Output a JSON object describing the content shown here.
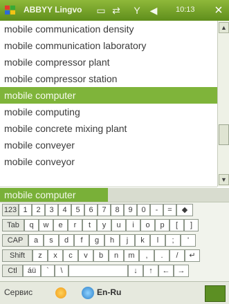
{
  "titlebar": {
    "title": "ABBYY Lingvo",
    "time": "10:13",
    "close": "×",
    "icons": [
      "windows-flag-icon",
      "window-icon",
      "connectivity-icon",
      "signal-icon",
      "volume-icon"
    ]
  },
  "list": {
    "items": [
      "mobile communication density",
      "mobile communication laboratory",
      "mobile compressor plant",
      "mobile compressor station",
      "mobile computer",
      "mobile computing",
      "mobile concrete mixing plant",
      "mobile conveyer",
      "mobile conveyor"
    ],
    "selected_index": 4
  },
  "input": {
    "value": "mobile computer"
  },
  "keyboard": {
    "row1": [
      "123",
      "1",
      "2",
      "3",
      "4",
      "5",
      "6",
      "7",
      "8",
      "9",
      "0",
      "-",
      "=",
      "◆"
    ],
    "row2": [
      "Tab",
      "q",
      "w",
      "e",
      "r",
      "t",
      "y",
      "u",
      "i",
      "o",
      "p",
      "[",
      "]"
    ],
    "row3": [
      "CAP",
      "a",
      "s",
      "d",
      "f",
      "g",
      "h",
      "j",
      "k",
      "l",
      ";",
      "'"
    ],
    "row4": [
      "Shift",
      "z",
      "x",
      "c",
      "v",
      "b",
      "n",
      "m",
      ",",
      ".",
      "/",
      "↵"
    ],
    "row5": [
      "Ctl",
      "áü",
      "`",
      "\\",
      "",
      "↓",
      "↑",
      "←",
      "→"
    ]
  },
  "bottombar": {
    "service": "Сервис",
    "language": "En-Ru"
  },
  "colors": {
    "accent": "#7fb43a",
    "title_bg": "#6f9f28"
  }
}
